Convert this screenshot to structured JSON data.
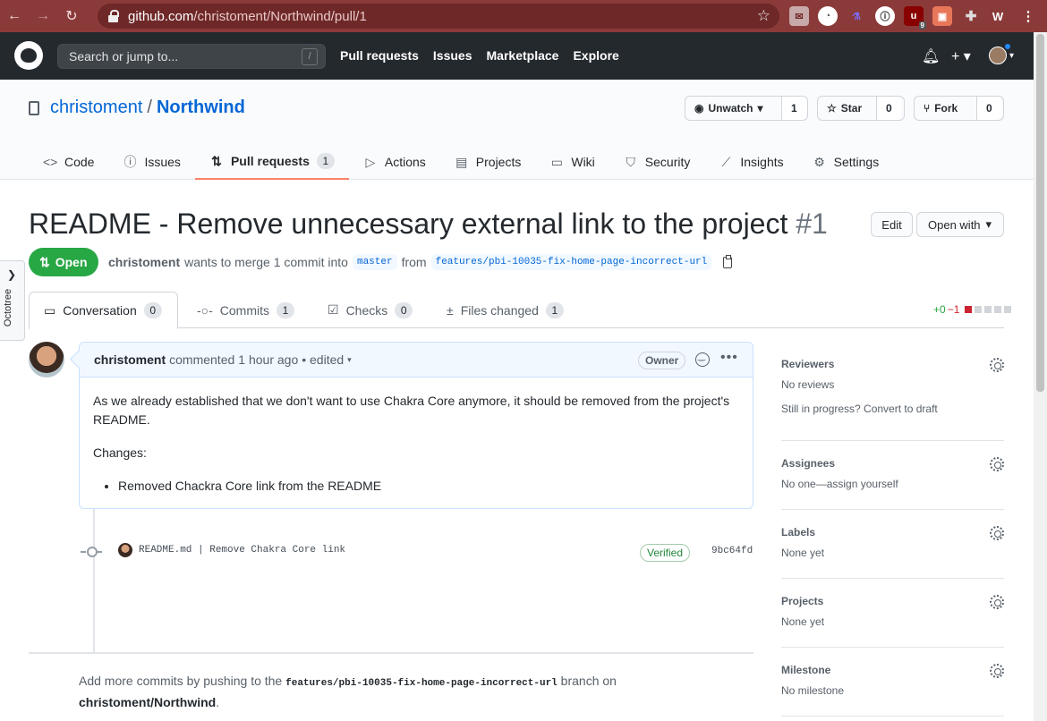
{
  "browser": {
    "url_host": "github.com",
    "url_path": "/christoment/Northwind/pull/1",
    "ext_badge": "9"
  },
  "header": {
    "search_placeholder": "Search or jump to...",
    "search_key": "/",
    "nav": [
      "Pull requests",
      "Issues",
      "Marketplace",
      "Explore"
    ]
  },
  "repo": {
    "owner": "christoment",
    "name": "Northwind",
    "unwatch_label": "Unwatch",
    "watch_count": "1",
    "star_label": "Star",
    "star_count": "0",
    "fork_label": "Fork",
    "fork_count": "0",
    "tabs": [
      {
        "label": "Code",
        "icon": "code-icon"
      },
      {
        "label": "Issues",
        "icon": "issue-icon"
      },
      {
        "label": "Pull requests",
        "icon": "pull-request-icon",
        "count": "1"
      },
      {
        "label": "Actions",
        "icon": "play-icon"
      },
      {
        "label": "Projects",
        "icon": "project-icon"
      },
      {
        "label": "Wiki",
        "icon": "book-icon"
      },
      {
        "label": "Security",
        "icon": "shield-icon"
      },
      {
        "label": "Insights",
        "icon": "graph-icon"
      },
      {
        "label": "Settings",
        "icon": "gear-icon"
      }
    ]
  },
  "octotree_label": "Octotree",
  "pr": {
    "title": "README - Remove unnecessary external link to the project",
    "number": "#1",
    "edit_label": "Edit",
    "open_with_label": "Open with",
    "state": "Open",
    "author": "christoment",
    "meta_text": "wants to merge 1 commit into",
    "base_branch": "master",
    "from_text": "from",
    "head_branch": "features/pbi-10035-fix-home-page-incorrect-url",
    "tabs": [
      {
        "label": "Conversation",
        "count": "0"
      },
      {
        "label": "Commits",
        "count": "1"
      },
      {
        "label": "Checks",
        "count": "0"
      },
      {
        "label": "Files changed",
        "count": "1"
      }
    ],
    "additions": "+0",
    "deletions": "−1"
  },
  "comment": {
    "author": "christoment",
    "action": "commented",
    "time": "1 hour ago",
    "edited": "• edited",
    "badge": "Owner",
    "body_p1": "As we already established that we don't want to use Chakra Core anymore, it should be removed from the project's README.",
    "body_p2": "Changes:",
    "body_li": "Removed Chackra Core link from the README"
  },
  "commit": {
    "message": "README.md | Remove Chakra Core link",
    "verified": "Verified",
    "sha": "9bc64fd"
  },
  "footer": {
    "text1": "Add more commits by pushing to the",
    "branch": "features/pbi-10035-fix-home-page-incorrect-url",
    "text2": "branch on",
    "repo": "christoment/Northwind",
    "end": "."
  },
  "sidebar": [
    {
      "title": "Reviewers",
      "value": "No reviews",
      "extra": "Still in progress? Convert to draft"
    },
    {
      "title": "Assignees",
      "value": "No one—assign yourself"
    },
    {
      "title": "Labels",
      "value": "None yet"
    },
    {
      "title": "Projects",
      "value": "None yet"
    },
    {
      "title": "Milestone",
      "value": "No milestone"
    }
  ],
  "colors": {
    "chrome": "#8b3a3a",
    "gh_header": "#24292e",
    "link": "#0366d6",
    "open_green": "#28a745",
    "tab_accent": "#f9826c"
  }
}
